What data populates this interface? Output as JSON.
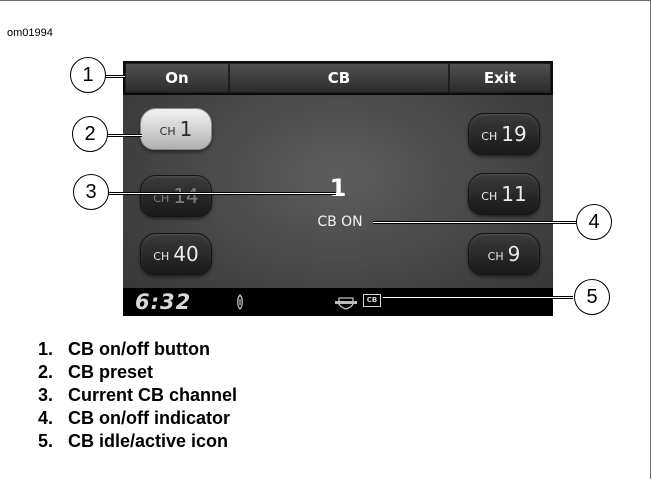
{
  "figure_id": "om01994",
  "screen": {
    "top_bar": {
      "on_label": "On",
      "title": "CB",
      "exit_label": "Exit"
    },
    "presets": [
      {
        "prefix": "CH",
        "number": "1"
      },
      {
        "prefix": "CH",
        "number": "14"
      },
      {
        "prefix": "CH",
        "number": "40"
      },
      {
        "prefix": "CH",
        "number": "19"
      },
      {
        "prefix": "CH",
        "number": "11"
      },
      {
        "prefix": "CH",
        "number": "9"
      }
    ],
    "current_channel": "1",
    "cb_status": "CB ON",
    "status_bar": {
      "time": "6:32",
      "cb_icon_text": "CB"
    }
  },
  "callouts": [
    "1",
    "2",
    "3",
    "4",
    "5"
  ],
  "legend": [
    {
      "num": "1.",
      "text": "CB on/off button"
    },
    {
      "num": "2.",
      "text": "CB preset"
    },
    {
      "num": "3.",
      "text": "Current CB channel"
    },
    {
      "num": "4.",
      "text": "CB on/off indicator"
    },
    {
      "num": "5.",
      "text": "CB idle/active icon"
    }
  ],
  "colors": {
    "active_preset": "#e6e6e6",
    "screen_bg": "#4a4a4a",
    "bar_bg": "#000000"
  }
}
